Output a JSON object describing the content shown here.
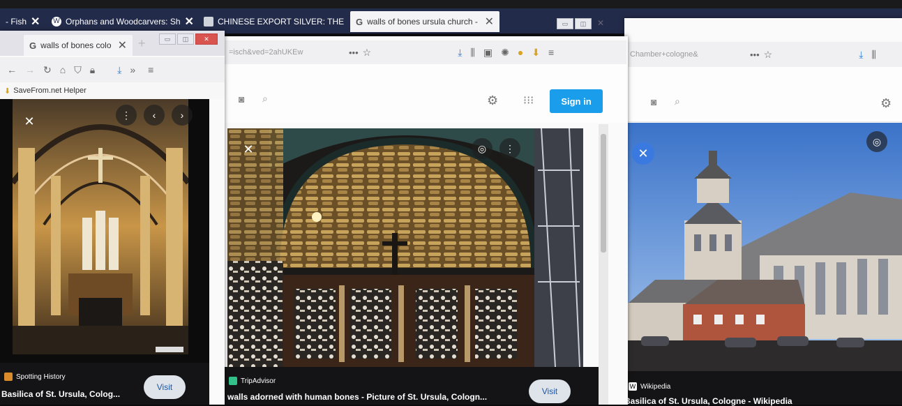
{
  "tabs": [
    {
      "label": "- Fish",
      "close": "✕"
    },
    {
      "label": "Orphans and Woodcarvers: Sh",
      "close": "✕"
    },
    {
      "label": "CHINESE EXPORT SILVER: THE",
      "close": "✕"
    },
    {
      "label": "walls of bones ursula church -",
      "close": "✕"
    }
  ],
  "win1": {
    "tab_label": "walls of bones colo",
    "tab_close": "✕",
    "new_tab": "+",
    "bookmark": "SaveFrom.net Helper",
    "caption": {
      "source": "Spotting History",
      "title": "Basilica of St. Ursula, Colog...",
      "visit": "Visit"
    }
  },
  "win2": {
    "url": "=isch&ved=2ahUKEw",
    "more": "•••",
    "signin": "Sign in",
    "caption": {
      "source": "TripAdvisor",
      "title": "walls adorned with human bones - Picture of St. Ursula, Cologn...",
      "visit": "Visit"
    }
  },
  "win3": {
    "url": "Chamber+cologne&",
    "more": "•••",
    "caption": {
      "source": "Wikipedia",
      "title": "Basilica of St. Ursula, Cologne - Wikipedia"
    }
  },
  "colors": {
    "tabstrip": "#232b4a",
    "signin": "#1a9dea",
    "caption_bg": "#141416"
  }
}
